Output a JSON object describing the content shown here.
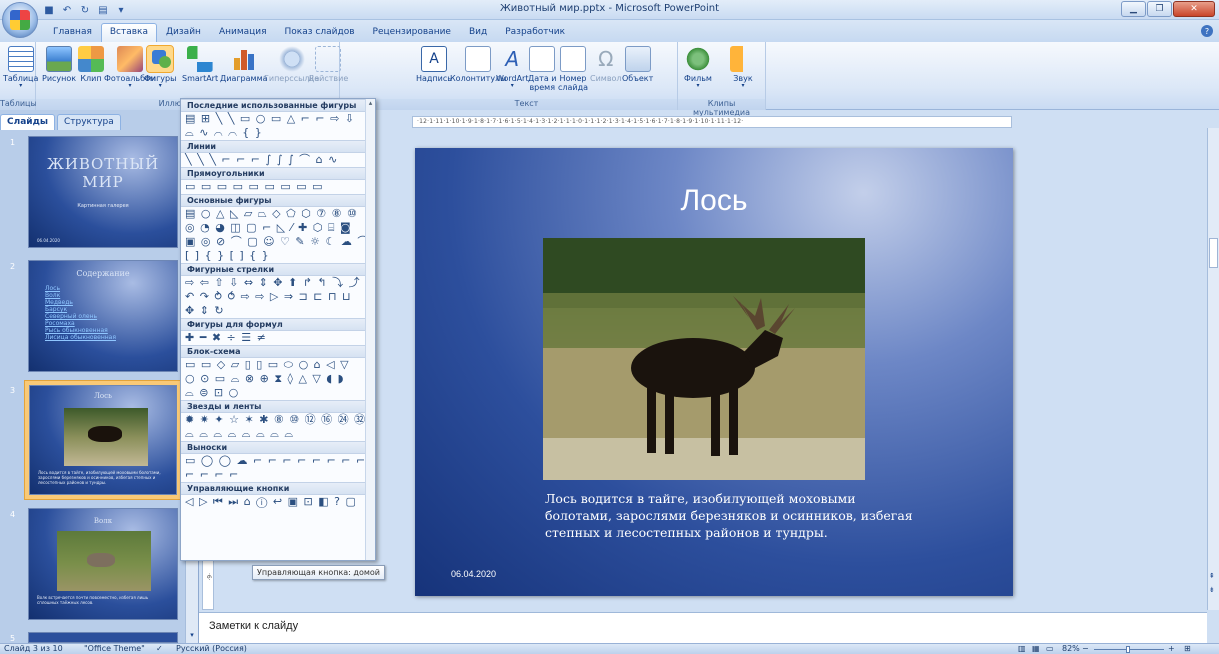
{
  "window": {
    "title": "Животный мир.pptx - Microsoft PowerPoint"
  },
  "tabs": [
    {
      "label": "Главная",
      "active": false
    },
    {
      "label": "Вставка",
      "active": true
    },
    {
      "label": "Дизайн",
      "active": false
    },
    {
      "label": "Анимация",
      "active": false
    },
    {
      "label": "Показ слайдов",
      "active": false
    },
    {
      "label": "Рецензирование",
      "active": false
    },
    {
      "label": "Вид",
      "active": false
    },
    {
      "label": "Разработчик",
      "active": false
    }
  ],
  "ribbon": {
    "groups": {
      "tables": "Таблицы",
      "illustrations": "Иллюстрации",
      "text": "Текст",
      "media": "Клипы мультимедиа"
    },
    "buttons": {
      "table": "Таблица",
      "picture": "Рисунок",
      "clip": "Клип",
      "photoalbum": "Фотоальбом",
      "shapes": "Фигуры",
      "smartart": "SmartArt",
      "chart": "Диаграмма",
      "hyperlink": "Гиперссылка",
      "action": "Действие",
      "textbox": "Надпись",
      "headerfooter": "Колонтитулы",
      "wordart": "WordArt",
      "datetime_1": "Дата и",
      "datetime_2": "время",
      "slidenum_1": "Номер",
      "slidenum_2": "слайда",
      "symbol": "Символ",
      "object": "Объект",
      "movie": "Фильм",
      "sound": "Звук"
    }
  },
  "left_panel": {
    "tabs": [
      "Слайды",
      "Структура"
    ],
    "close": "×",
    "slides": [
      {
        "num": "1",
        "title": "ЖИВОТНЫЙ МИР",
        "subtitle": "Картинная галерея",
        "date": "06.04.2020"
      },
      {
        "num": "2",
        "title": "Содержание",
        "links": [
          "Лось",
          "Волк",
          "Медведь",
          "Барсук",
          "Северный олень",
          "Росомаха",
          "Рысь обыкновенная",
          "Лисица обыкновенная"
        ]
      },
      {
        "num": "3",
        "title": "Лось",
        "text": "Лось водится в тайге, изобилующей моховыми болотами, зарослями березняков и осинников, избегая степных и лесостепных районов и тундры."
      },
      {
        "num": "4",
        "title": "Волк",
        "text": "Волк встречается почти повсеместно, избегая лишь сплошных таёжных лесов."
      },
      {
        "num": "5"
      }
    ]
  },
  "shapes_menu": {
    "sections": [
      {
        "title": "Последние использованные фигуры",
        "rows": [
          "▤ ⊞ ╲ ╲ ▭ ○ ▭ △ ⌐ ⌐ ⇨ ⇩",
          "⌓ ∿ ⌒ ⌒ { }"
        ]
      },
      {
        "title": "Линии",
        "rows": [
          "╲ ╲ ╲ ⌐ ⌐ ⌐ ∫ ∫ ∫ ⌒ ⌂ ∿"
        ]
      },
      {
        "title": "Прямоугольники",
        "rows": [
          "▭ ▭ ▭ ▭ ▭ ▭ ▭ ▭ ▭"
        ]
      },
      {
        "title": "Основные фигуры",
        "rows": [
          "▤ ○ △ ◺ ▱ ⏢ ◇ ⬠ ⬡ ⑦ ⑧ ⑩",
          "◎ ◔ ◕ ◫ ▢ ⌐ ◺ ⁄ ✚ ⬡ ⌸ ◙",
          "▣ ◎ ⊘ ⌒ ▢ ☺ ♡ ✎ ☼ ☾ ☁ ⌒",
          "[ ] { } [ ] { }"
        ]
      },
      {
        "title": "Фигурные стрелки",
        "rows": [
          "⇨ ⇦ ⇧ ⇩ ⇔ ⇕ ✥ ⬆ ↱ ↰ ⤵ ⤴",
          "↶ ↷ ⥁ ⥀ ⇨ ⇨ ▷ ⇒ ⊐ ⊏ ⊓ ⊔",
          "✥ ⇕ ↻"
        ]
      },
      {
        "title": "Фигуры для формул",
        "rows": [
          "✚ ━ ✖ ÷ ☰ ≠"
        ]
      },
      {
        "title": "Блок-схема",
        "rows": [
          "▭ ▭ ◇ ▱ ▯ ▯ ▭ ⬭ ○ ⌂ ◁ ▽",
          "○ ⊙ ▭ ⌓ ⊗ ⊕ ⧗ ◊ △ ▽ ◖ ◗",
          "⌓ ⊜ ⊡ ○"
        ]
      },
      {
        "title": "Звезды и ленты",
        "rows": [
          "✹ ✷ ✦ ☆ ✶ ✱ ⑧ ⑩ ⑫ ⑯ ㉔ ㉜",
          "⌓ ⌓ ⌓ ⌓ ⌓ ⌓ ⌓ ⌓"
        ]
      },
      {
        "title": "Выноски",
        "rows": [
          "▭ ◯ ◯ ☁ ⌐ ⌐ ⌐ ⌐ ⌐ ⌐ ⌐ ⌐",
          "⌐ ⌐ ⌐ ⌐"
        ]
      },
      {
        "title": "Управляющие кнопки",
        "rows": [
          "◁ ▷ ⏮ ⏭ ⌂ ⓘ ↩ ▣ ⊡ ◧ ? ▢"
        ]
      }
    ],
    "tooltip": "Управляющая кнопка: домой"
  },
  "ruler": {
    "marks": "·12·1·11·1·10·1·9·1·8·1·7·1·6·1·5·1·4·1·3·1·2·1·1·1·0·1·1·1·2·1·3·1·4·1·5·1·6·1·7·1·8·1·9·1·10·1·11·1·12·"
  },
  "vruler": {
    "marks": "·6·"
  },
  "slide": {
    "title": "Лось",
    "body": "Лось водится в тайге, изобилующей моховыми болотами, зарослями березняков и осинников, избегая степных и лесостепных районов и тундры.",
    "date": "06.04.2020"
  },
  "notes": {
    "placeholder": "Заметки к слайду"
  },
  "statusbar": {
    "slide_info": "Слайд 3 из 10",
    "theme": "\"Office Theme\"",
    "language": "Русский (Россия)",
    "zoom": "82%",
    "minus": "−",
    "plus": "+"
  },
  "colors": {
    "accent": "#15428b",
    "slide_dark": "#16337a",
    "selected_thumb": "#f9c977"
  }
}
